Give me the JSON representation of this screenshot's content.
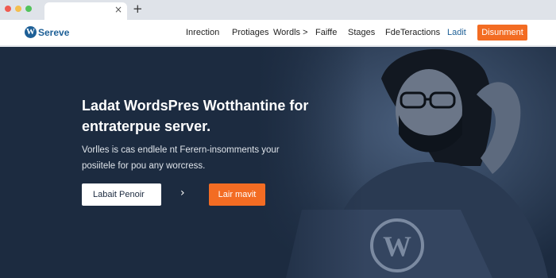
{
  "browser": {
    "tab_close": "×",
    "new_tab": "+"
  },
  "navbar": {
    "logo_text": "Sereve",
    "logo_icon_glyph": "W",
    "items": [
      {
        "label": "Inrection"
      },
      {
        "label": "Protiages"
      },
      {
        "label": "Wordls >"
      },
      {
        "label": "Faiffe"
      },
      {
        "label": "Stages"
      },
      {
        "label": "FdeTeractions"
      }
    ],
    "link_label": "Ladit",
    "cta_label": "Disunment"
  },
  "hero": {
    "headline": "Ladat WordsPres Wotthantine for entraterpue server.",
    "subtext": "Vorlles is cas endlele nt Ferern-insomments your posiitele for pou any worcress.",
    "primary_button": "Labait Penoir",
    "chevron": "›",
    "orange_button": "Lair mavit"
  },
  "colors": {
    "brand_blue": "#1d5f96",
    "accent_orange": "#f36c23",
    "hero_bg": "#1c2b40"
  },
  "icons": [
    "close-icon",
    "plus-icon",
    "wordpress-logo-icon",
    "chevron-right-icon"
  ]
}
